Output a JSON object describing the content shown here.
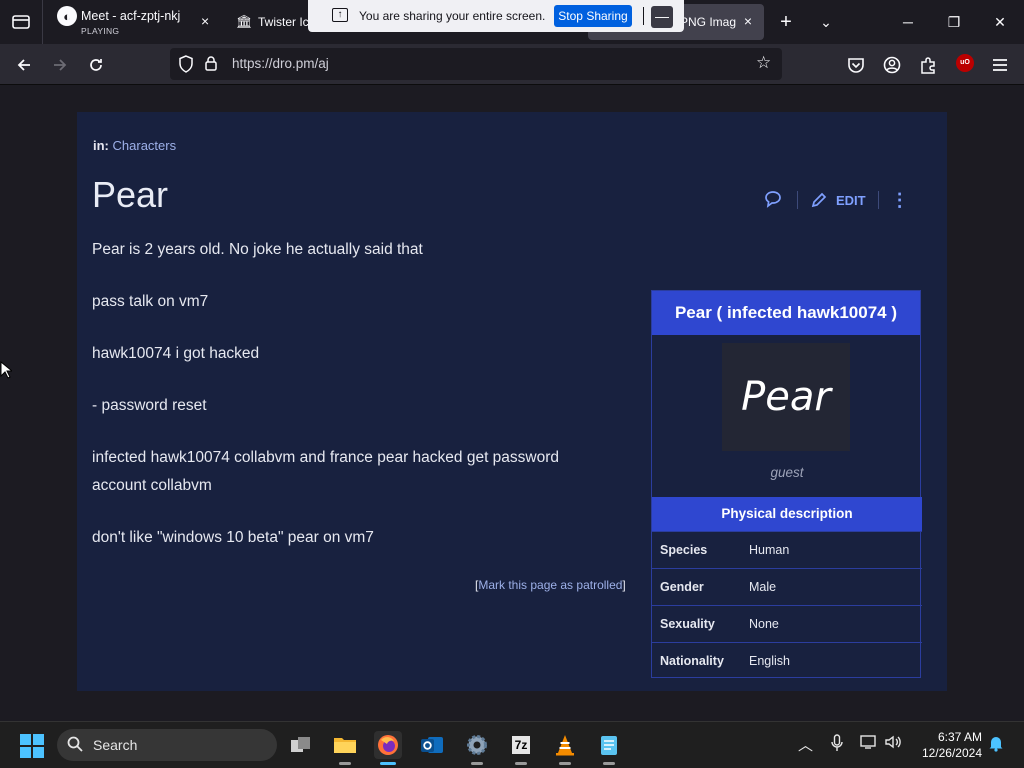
{
  "browser": {
    "tabs": [
      {
        "title": "Meet - acf-zptj-nkj",
        "subtitle": "PLAYING",
        "close": "×"
      },
      {
        "title": "Twister Ic",
        "close": ""
      },
      {
        "title": "PNG Imag",
        "close": "×"
      }
    ],
    "new_tab": "+",
    "list_tabs": "⌄",
    "url": "https://dro.pm/aj",
    "window": {
      "minimize": "─",
      "restore": "❐",
      "close": "✕"
    }
  },
  "sharing_bar": {
    "message": "You are sharing your entire screen.",
    "stop_label": "Stop Sharing",
    "minimize": "—"
  },
  "page": {
    "breadcrumb_prefix": "in:",
    "breadcrumb_link": "Characters",
    "title": "Pear",
    "edit_label": "EDIT",
    "paragraphs": [
      "Pear is 2 years old. No joke he actually said that",
      "pass talk on vm7",
      "hawk10074 i got hacked",
      "- password reset",
      "infected hawk10074 collabvm and france pear hacked get password account collabvm",
      "don't like \"windows 10 beta\" pear on vm7"
    ],
    "patrol_open": "[",
    "patrol_link": "Mark this page as patrolled",
    "patrol_close": "]"
  },
  "infobox": {
    "title": "Pear ( infected hawk10074 )",
    "image_text": "Pear",
    "caption": "guest",
    "section": "Physical description",
    "rows": [
      {
        "key": "Species",
        "value": "Human"
      },
      {
        "key": "Gender",
        "value": "Male"
      },
      {
        "key": "Sexuality",
        "value": "None"
      },
      {
        "key": "Nationality",
        "value": "English"
      }
    ]
  },
  "taskbar": {
    "search_label": "Search",
    "time": "6:37 AM",
    "date": "12/26/2024",
    "app_7z_label": "7z"
  },
  "colors": {
    "card_bg": "#18213f",
    "accent_blue": "#2f47d0",
    "link": "#9db0e8",
    "share_button": "#0060df"
  }
}
